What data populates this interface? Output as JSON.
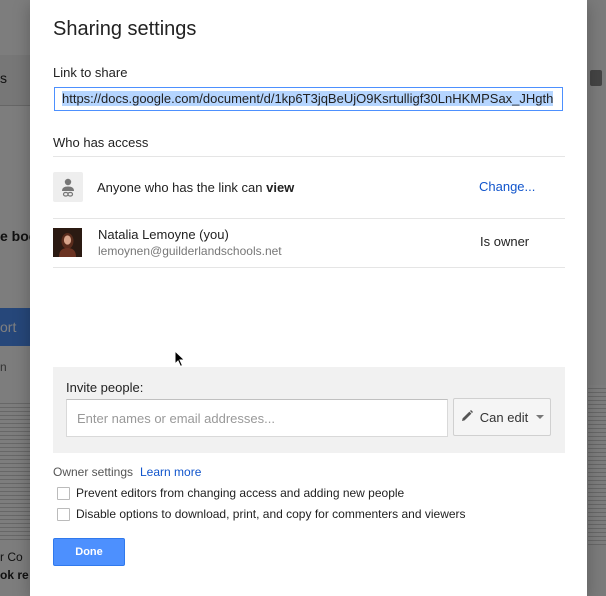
{
  "dialog": {
    "title": "Sharing settings",
    "link_label": "Link to share",
    "link_url": "https://docs.google.com/document/d/1kp6T3jqBeUjO9Ksrtulligf30LnHKMPSax_JHgth",
    "who_has_access_label": "Who has access",
    "access": {
      "prefix": "Anyone who has the link can ",
      "level": "view",
      "change_link": "Change...",
      "icon": "link-people-icon"
    },
    "owner": {
      "name": "Natalia Lemoyne (you)",
      "email": "lemoynen@guilderlandschools.net",
      "role": "Is owner",
      "avatar": "user-avatar"
    },
    "invite": {
      "label": "Invite people:",
      "placeholder": "Enter names or email addresses...",
      "permission": "Can edit",
      "icon": "pencil-icon"
    },
    "owner_settings": {
      "label": "Owner settings",
      "learn_more": "Learn more",
      "options": [
        {
          "label": "Prevent editors from changing access and adding new people",
          "checked": false
        },
        {
          "label": "Disable options to download, print, and copy for commenters and viewers",
          "checked": false
        }
      ]
    },
    "done_label": "Done"
  },
  "background": {
    "fragments": [
      "s",
      "e boc",
      "ort",
      "n",
      "r Co",
      "ok re"
    ]
  },
  "colors": {
    "accent": "#4d90fe",
    "link": "#1155cc",
    "selection": "#b5d5ff"
  }
}
